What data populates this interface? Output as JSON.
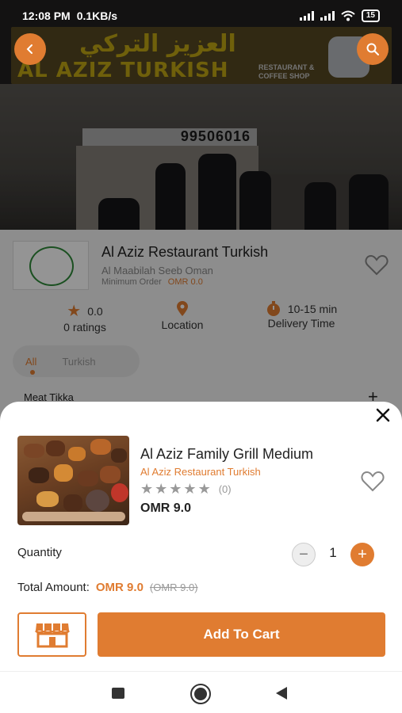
{
  "status_bar": {
    "time": "12:08 PM",
    "speed": "0.1KB/s",
    "battery": "15"
  },
  "hero": {
    "sign_arabic": "العزيز التركي",
    "sign_english": "AL AZIZ TURKISH",
    "sign_sub": "RESTAURANT & COFFEE SHOP",
    "phone_number": "99506016"
  },
  "restaurant": {
    "name": "Al Aziz Restaurant Turkish",
    "area": "Al Maabilah Seeb Oman",
    "min_order_label": "Minimum Order",
    "min_order_value": "OMR 0.0",
    "rating_value": "0.0",
    "rating_label": "0 ratings",
    "location_label": "Location",
    "delivery_value": "10-15 min",
    "delivery_label": "Delivery Time",
    "categories": [
      "All",
      "Turkish"
    ],
    "menu_item": "Meat Tikka"
  },
  "product": {
    "name": "Al Aziz Family Grill Medium",
    "restaurant": "Al Aziz Restaurant Turkish",
    "rating_count": "(0)",
    "price": "OMR 9.0",
    "quantity_label": "Quantity",
    "quantity": "1",
    "total_label": "Total Amount:",
    "total_amount": "OMR 9.0",
    "total_old": "(OMR 9.0)",
    "add_to_cart": "Add To Cart"
  },
  "icons": {
    "back": "chevron-left-icon",
    "search": "search-icon",
    "favorite": "heart-outline-icon",
    "rating": "star-icon",
    "location": "location-pin-icon",
    "delivery": "timer-icon",
    "close": "close-icon",
    "store": "store-icon"
  },
  "colors": {
    "accent": "#e07c31",
    "text": "#222222",
    "muted": "#999999"
  }
}
